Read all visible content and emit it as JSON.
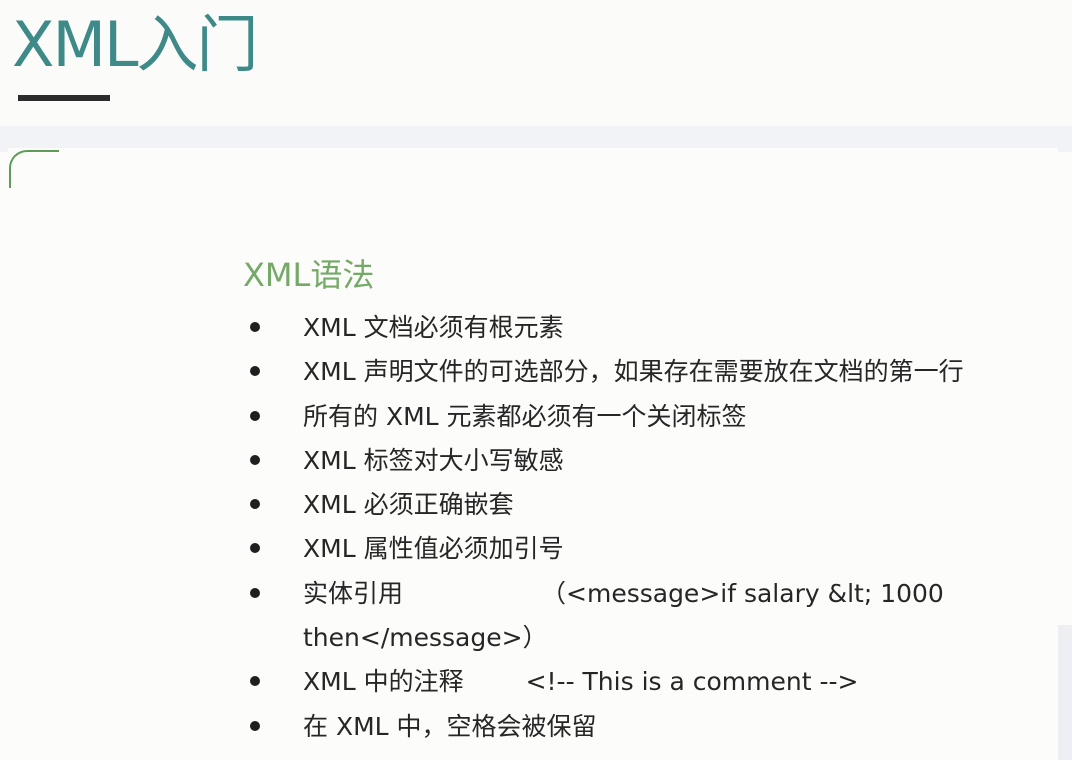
{
  "page": {
    "title": "XML入门"
  },
  "section": {
    "heading": "XML语法"
  },
  "rules": [
    "XML 文档必须有根元素",
    "XML 声明文件的可选部分，如果存在需要放在文档的第一行",
    "所有的 XML 元素都必须有一个关闭标签",
    "XML 标签对大小写敏感",
    "XML 必须正确嵌套",
    "XML 属性值必须加引号",
    {
      "label": "实体引用",
      "example": "（<message>if salary &lt; 1000 then</message>）"
    },
    {
      "label": "XML 中的注释",
      "example": "<!-- This is a comment -->"
    },
    "在 XML 中，空格会被保留"
  ],
  "colors": {
    "title": "#3e8a88",
    "heading": "#74a968",
    "accent": "#5e9c56",
    "text": "#262626"
  }
}
